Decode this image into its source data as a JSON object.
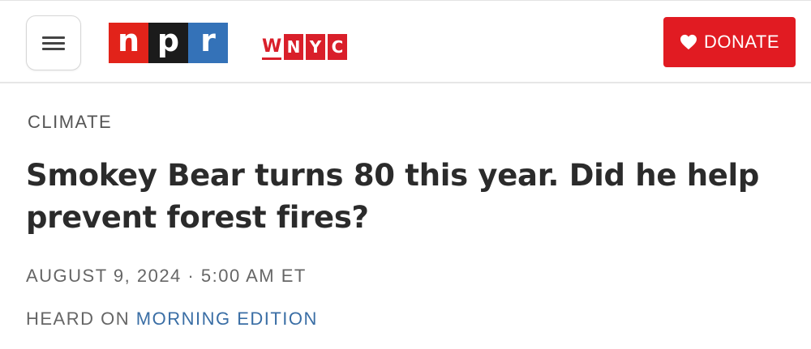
{
  "header": {
    "menu_icon": "hamburger-menu-icon",
    "npr_logo": {
      "letters": [
        "n",
        "p",
        "r"
      ],
      "colors": [
        "#e2231a",
        "#1b1b1b",
        "#3472b8"
      ]
    },
    "wnyc_logo": {
      "letters": [
        "W",
        "N",
        "Y",
        "C"
      ],
      "color": "#d91f2a"
    },
    "donate": {
      "label": "DONATE",
      "icon": "heart-icon",
      "color": "#e11b22"
    }
  },
  "article": {
    "section": "CLIMATE",
    "headline": "Smokey Bear turns 80 this year. Did he help prevent forest fires?",
    "date": "AUGUST 9, 2024",
    "separator": "·",
    "time": "5:00 AM ET",
    "heard_on_label": "HEARD ON",
    "program": "MORNING EDITION",
    "program_color": "#3a6ea5"
  }
}
